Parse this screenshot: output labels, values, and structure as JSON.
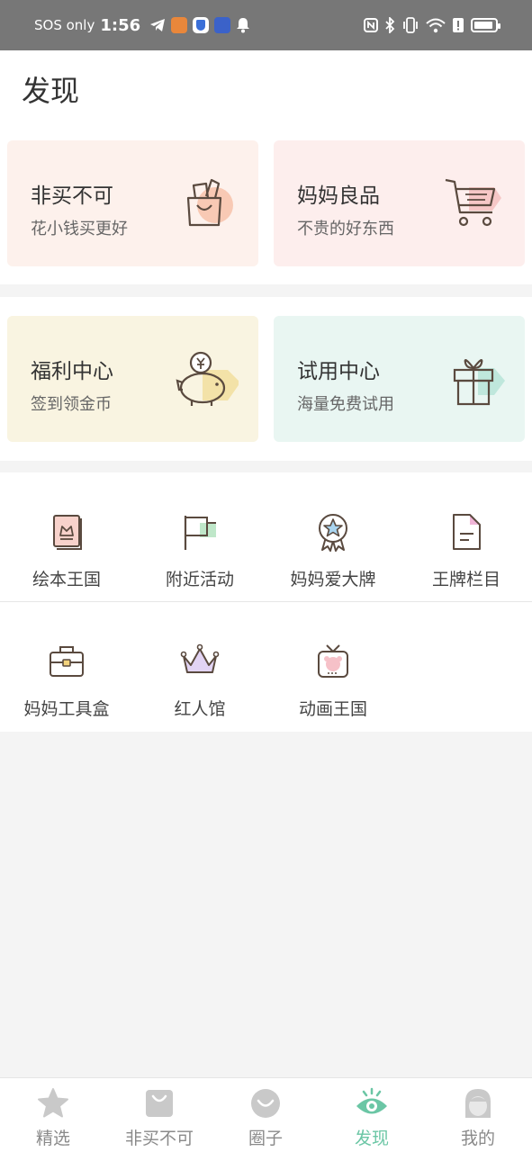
{
  "status_bar": {
    "carrier": "SOS only",
    "time": "1:56"
  },
  "header": {
    "title": "发现"
  },
  "cards": [
    {
      "title": "非买不可",
      "subtitle": "花小钱买更好",
      "icon": "shopping-bag-icon",
      "bg": "#fdf1ec"
    },
    {
      "title": "妈妈良品",
      "subtitle": "不贵的好东西",
      "icon": "shopping-cart-icon",
      "bg": "#fdeeed"
    },
    {
      "title": "福利中心",
      "subtitle": "签到领金币",
      "icon": "piggy-bank-icon",
      "bg": "#f9f4e1"
    },
    {
      "title": "试用中心",
      "subtitle": "海量免费试用",
      "icon": "gift-box-icon",
      "bg": "#e9f6f2"
    }
  ],
  "grid": [
    {
      "label": "绘本王国",
      "icon": "picture-book-icon"
    },
    {
      "label": "附近活动",
      "icon": "flag-icon"
    },
    {
      "label": "妈妈爱大牌",
      "icon": "award-badge-icon"
    },
    {
      "label": "王牌栏目",
      "icon": "document-icon"
    },
    {
      "label": "妈妈工具盒",
      "icon": "toolbox-icon"
    },
    {
      "label": "红人馆",
      "icon": "crown-icon"
    },
    {
      "label": "动画王国",
      "icon": "tv-icon"
    }
  ],
  "tabs": [
    {
      "label": "精选",
      "icon": "star-icon",
      "active": false
    },
    {
      "label": "非买不可",
      "icon": "bag-icon",
      "active": false
    },
    {
      "label": "圈子",
      "icon": "smile-icon",
      "active": false
    },
    {
      "label": "发现",
      "icon": "eye-icon",
      "active": true
    },
    {
      "label": "我的",
      "icon": "user-icon",
      "active": false
    }
  ],
  "colors": {
    "accent": "#6bc6a5",
    "tab_inactive": "#c9c9c9",
    "page_bg": "#f4f4f4"
  }
}
